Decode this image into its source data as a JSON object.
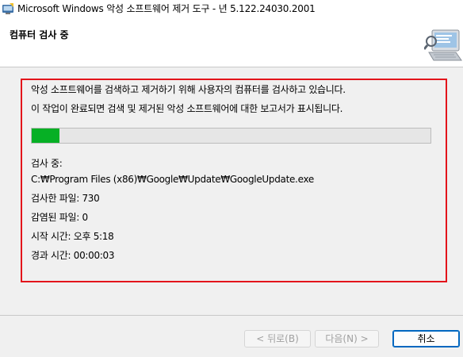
{
  "window": {
    "title": "Microsoft Windows 악성 소프트웨어 제거 도구 - 년 5.122.24030.2001"
  },
  "header": {
    "title": "컴퓨터 검사 중",
    "icon": "scanning-computer-icon"
  },
  "main": {
    "description_line1": "악성 소프트웨어를 검색하고 제거하기 위해 사용자의 컴퓨터를 검사하고 있습니다.",
    "description_line2": "이 작업이 완료되면 검색 및 제거된 악성 소프트웨어에 대한 보고서가 표시됩니다.",
    "progress_fraction": 0.07,
    "progress_color": "#06b025",
    "scanning_label": "검사 중:",
    "scanning_path": "C:₩Program Files (x86)₩Google₩Update₩GoogleUpdate.exe",
    "scanned_files": "검사한 파일: 730",
    "infected_files": "감염된 파일: 0",
    "start_time": "시작 시간: 오후 5:18",
    "elapsed_time": "경과 시간: 00:00:03",
    "highlight_color": "#e3141b"
  },
  "footer": {
    "back_label": "< 뒤로(B)",
    "next_label": "다음(N) >",
    "cancel_label": "취소"
  }
}
